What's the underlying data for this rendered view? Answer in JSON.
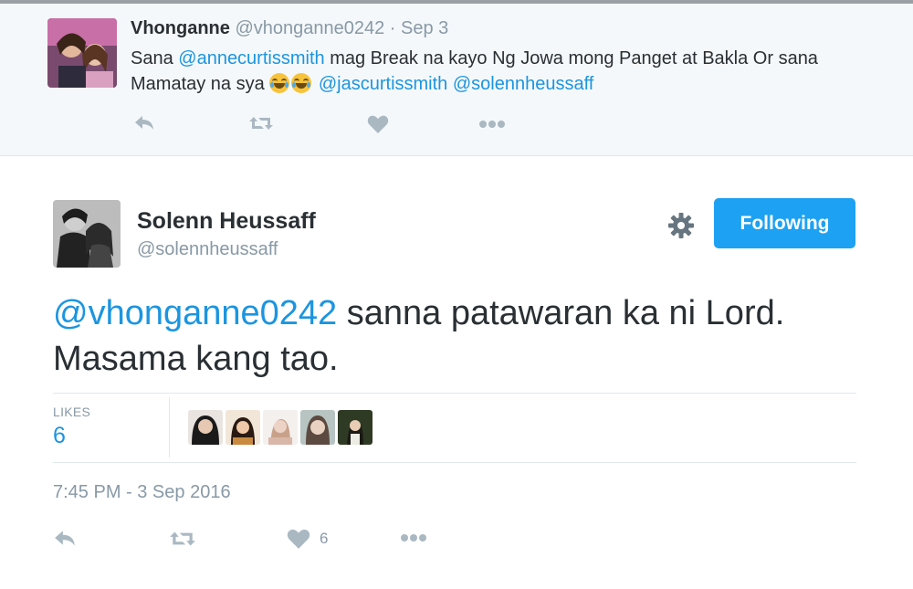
{
  "reply_tweet": {
    "name": "Vhonganne",
    "handle": "@vhonganne0242",
    "separator": "·",
    "date": "Sep 3",
    "text_1": "Sana ",
    "mention_1": "@annecurtissmith",
    "text_2": "  mag Break na kayo Ng Jowa mong Panget at Bakla Or sana Mamatay na sya ",
    "mention_2": "@jascurtissmith",
    "mention_3": "@solennheussaff",
    "emoji": [
      "face-with-tears-of-joy",
      "face-with-tears-of-joy"
    ],
    "actions": [
      "reply-icon",
      "retweet-icon",
      "like-icon",
      "more-icon"
    ]
  },
  "main_tweet": {
    "name": "Solenn Heussaff",
    "handle": "@solennheussaff",
    "follow_label": "Following",
    "mention": "@vhonganne0242",
    "text": " sanna patawaran ka ni Lord. Masama kang tao.",
    "likes_label": "LIKES",
    "likes_count": "6",
    "liker_count": 5,
    "timestamp": "7:45 PM - 3 Sep 2016",
    "action_like_count": "6",
    "actions": [
      "reply-icon",
      "retweet-icon",
      "like-icon",
      "more-icon"
    ]
  },
  "colors": {
    "link": "#1b95e0",
    "follow_button": "#1da1f2",
    "muted": "#8899a6",
    "icon": "#aab8c2",
    "reply_bg": "#f5f8fa"
  }
}
